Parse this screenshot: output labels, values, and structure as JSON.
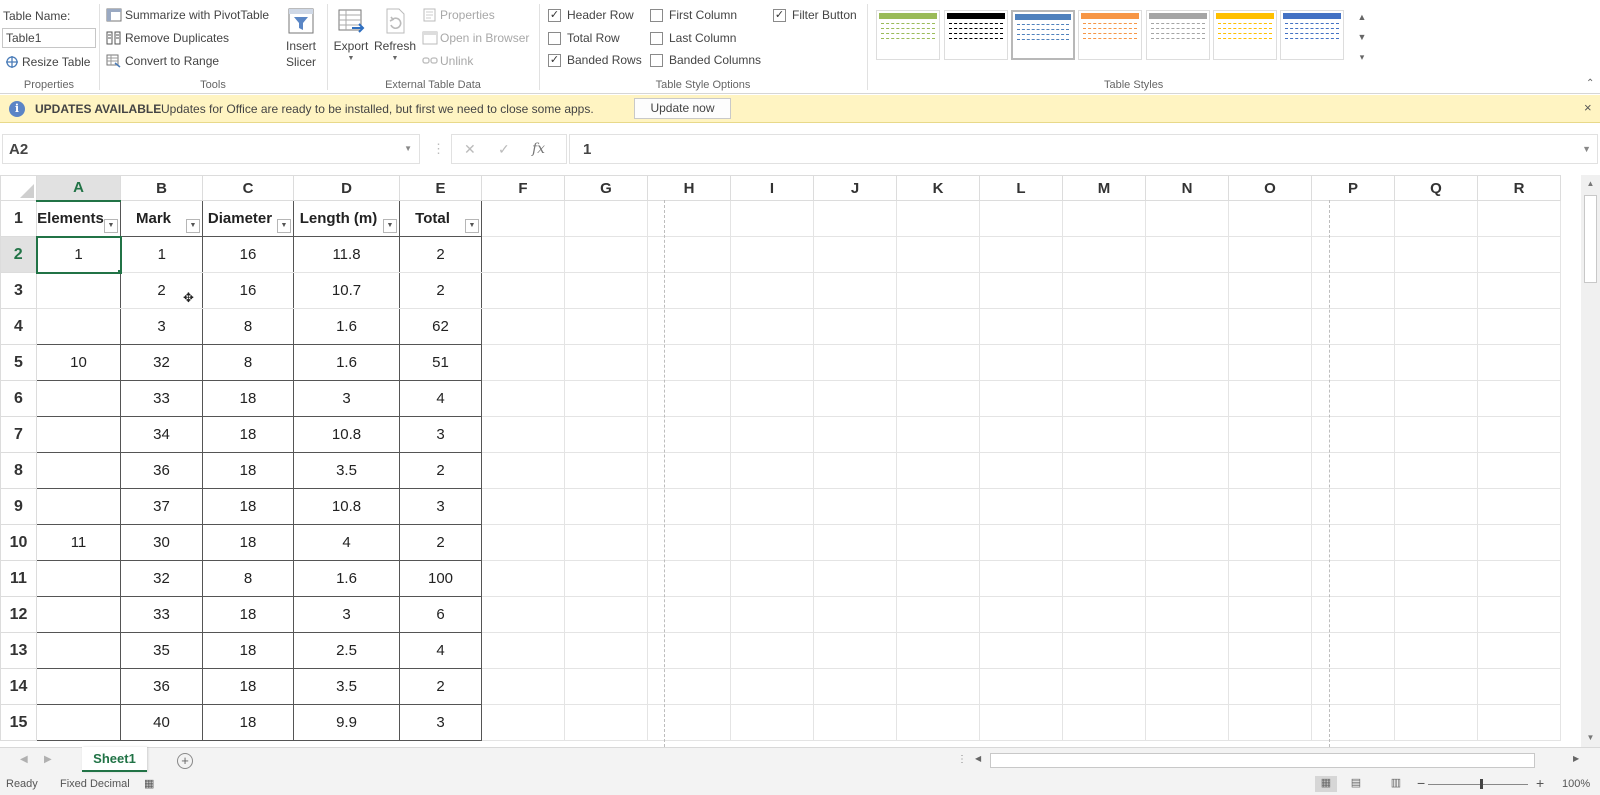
{
  "ribbon": {
    "properties": {
      "table_name_label": "Table Name:",
      "table_name_value": "Table1",
      "resize_label": "Resize Table",
      "group_label": "Properties"
    },
    "tools": {
      "summarize_label": "Summarize with PivotTable",
      "remove_dup_label": "Remove Duplicates",
      "convert_label": "Convert to Range",
      "insert_label_1": "Insert",
      "insert_label_2": "Slicer",
      "group_label": "Tools"
    },
    "external": {
      "export_label": "Export",
      "refresh_label": "Refresh",
      "properties_label": "Properties",
      "open_browser_label": "Open in Browser",
      "unlink_label": "Unlink",
      "group_label": "External Table Data"
    },
    "style_options": {
      "header_row": "Header Row",
      "total_row": "Total Row",
      "banded_rows": "Banded Rows",
      "first_column": "First Column",
      "last_column": "Last Column",
      "banded_columns": "Banded Columns",
      "filter_button": "Filter Button",
      "group_label": "Table Style Options"
    },
    "styles": {
      "group_label": "Table Styles",
      "swatches": [
        "#9bbb59",
        "#000000",
        "#4f81bd",
        "#f79646",
        "#a5a5a5",
        "#ffc000",
        "#4472c4"
      ]
    }
  },
  "infobar": {
    "title": "UPDATES AVAILABLE",
    "message": "Updates for Office are ready to be installed, but first we need to close some apps.",
    "button": "Update now",
    "close": "×"
  },
  "formula_bar": {
    "name_box": "A2",
    "fx": "fx",
    "value": "1"
  },
  "columns": [
    "A",
    "B",
    "C",
    "D",
    "E",
    "F",
    "G",
    "H",
    "I",
    "J",
    "K",
    "L",
    "M",
    "N",
    "O",
    "P",
    "Q",
    "R"
  ],
  "table": {
    "headers": [
      "Elements",
      "Mark",
      "Diameter",
      "Length (m)",
      "Total"
    ],
    "rows": [
      [
        "1",
        "1",
        "16",
        "11.8",
        "2"
      ],
      [
        "",
        "2",
        "16",
        "10.7",
        "2"
      ],
      [
        "",
        "3",
        "8",
        "1.6",
        "62"
      ],
      [
        "10",
        "32",
        "8",
        "1.6",
        "51"
      ],
      [
        "",
        "33",
        "18",
        "3",
        "4"
      ],
      [
        "",
        "34",
        "18",
        "10.8",
        "3"
      ],
      [
        "",
        "36",
        "18",
        "3.5",
        "2"
      ],
      [
        "",
        "37",
        "18",
        "10.8",
        "3"
      ],
      [
        "11",
        "30",
        "18",
        "4",
        "2"
      ],
      [
        "",
        "32",
        "8",
        "1.6",
        "100"
      ],
      [
        "",
        "33",
        "18",
        "3",
        "6"
      ],
      [
        "",
        "35",
        "18",
        "2.5",
        "4"
      ],
      [
        "",
        "36",
        "18",
        "3.5",
        "2"
      ],
      [
        "",
        "40",
        "18",
        "9.9",
        "3"
      ]
    ]
  },
  "row_numbers": [
    "1",
    "2",
    "3",
    "4",
    "5",
    "6",
    "7",
    "8",
    "9",
    "10",
    "11",
    "12",
    "13",
    "14",
    "15"
  ],
  "sheet_tab": "Sheet1",
  "status": {
    "ready": "Ready",
    "fixed_decimal": "Fixed Decimal",
    "zoom": "100%"
  },
  "colors": {
    "accent_green": "#217346",
    "info_bg": "#fff4c2"
  }
}
